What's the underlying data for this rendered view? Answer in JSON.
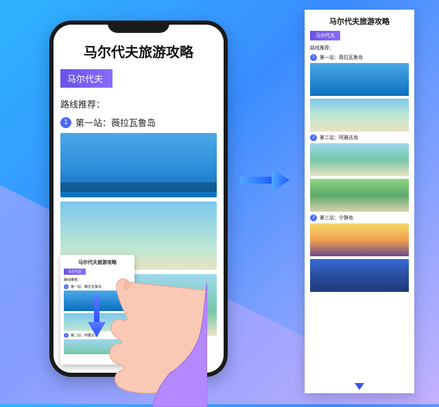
{
  "page_title": "马尔代夫旅游攻略",
  "location_tag": "马尔代夫",
  "route_label": "路线推荐：",
  "stops": [
    {
      "num": "1",
      "label": "第一站：薇拉瓦鲁岛"
    },
    {
      "num": "2",
      "label": "第二站：阿雅达岛"
    },
    {
      "num": "3",
      "label": "第三站：宁静岛"
    }
  ],
  "mini": {
    "title": "马尔代夫旅游攻略",
    "tag": "马尔代夫",
    "route_label": "路线推荐：",
    "stop1_num": "1",
    "stop1_label": "第一站：薇拉瓦鲁岛",
    "stop2_num": "2",
    "stop2_label": "第二站：阿雅达岛"
  }
}
